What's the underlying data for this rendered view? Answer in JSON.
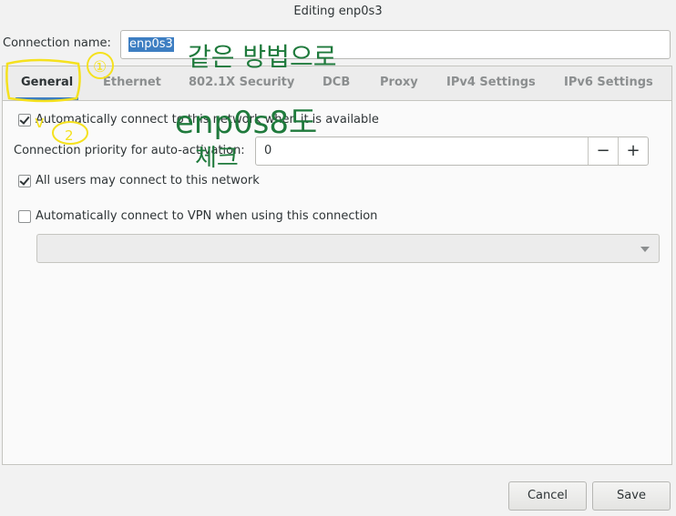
{
  "window": {
    "title": "Editing enp0s3"
  },
  "connection": {
    "label": "Connection name:",
    "value": "enp0s3"
  },
  "tabs": [
    {
      "label": "General",
      "active": true
    },
    {
      "label": "Ethernet"
    },
    {
      "label": "802.1X Security"
    },
    {
      "label": "DCB"
    },
    {
      "label": "Proxy"
    },
    {
      "label": "IPv4 Settings"
    },
    {
      "label": "IPv6 Settings"
    }
  ],
  "general": {
    "auto_connect": {
      "label": "Automatically connect to this network when it is available",
      "checked": true
    },
    "priority": {
      "label": "Connection priority for auto-activation:",
      "value": "0",
      "minus": "−",
      "plus": "+"
    },
    "all_users": {
      "label": "All users may connect to this network",
      "checked": true
    },
    "vpn": {
      "label": "Automatically connect to VPN when using this connection",
      "checked": false,
      "selected": ""
    }
  },
  "buttons": {
    "cancel": "Cancel",
    "save": "Save"
  },
  "annotations": {
    "step1": "①",
    "step2": "2",
    "check_mark": "v",
    "note_line1": "같은 방법으로",
    "note_line2": "enp0s8도",
    "note_line3": "체크",
    "colors": {
      "yellow": "#f5e11e",
      "green": "#1f7a3c"
    }
  }
}
